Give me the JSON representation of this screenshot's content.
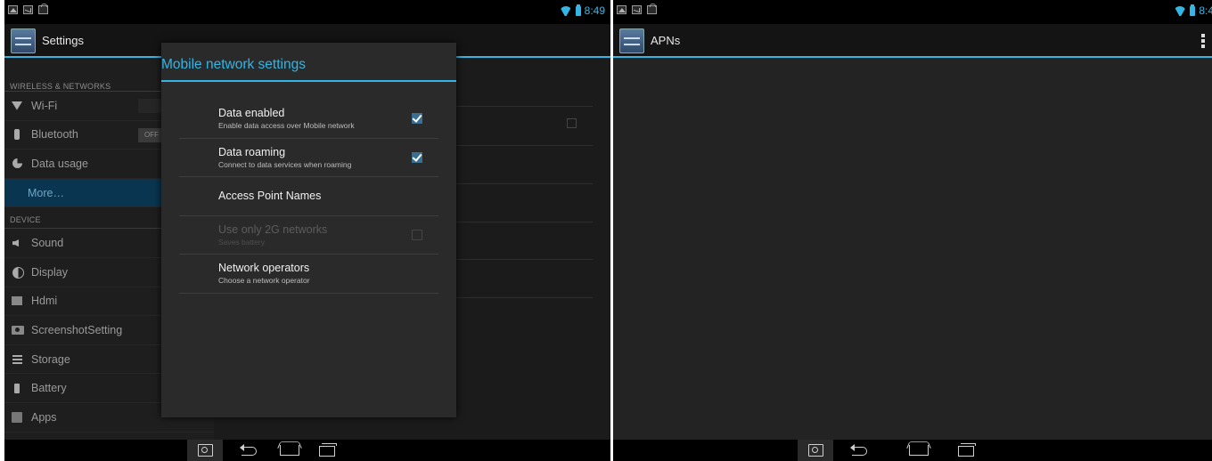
{
  "left_screen": {
    "status_bar": {
      "time": "8:49"
    },
    "action_bar": {
      "title": "Settings"
    },
    "settings_list": {
      "sections": [
        {
          "header": "WIRELESS & NETWORKS"
        },
        {
          "header": "DEVICE"
        }
      ],
      "items": [
        {
          "label": "Wi-Fi",
          "icon": "wifi-icon"
        },
        {
          "label": "Bluetooth",
          "icon": "bluetooth-icon",
          "toggle": "OFF"
        },
        {
          "label": "Data usage",
          "icon": "data-usage-icon"
        },
        {
          "label": "More…",
          "icon": "",
          "selected": true
        },
        {
          "label": "Sound",
          "icon": "sound-icon"
        },
        {
          "label": "Display",
          "icon": "display-icon"
        },
        {
          "label": "Hdmi",
          "icon": "hdmi-icon"
        },
        {
          "label": "ScreenshotSetting",
          "icon": "camera-icon"
        },
        {
          "label": "Storage",
          "icon": "storage-icon"
        },
        {
          "label": "Battery",
          "icon": "battery-icon"
        },
        {
          "label": "Apps",
          "icon": "apps-icon"
        }
      ]
    },
    "dialog": {
      "title": "Mobile network settings",
      "items": [
        {
          "title": "Data enabled",
          "summary": "Enable data access over Mobile network",
          "checked": true
        },
        {
          "title": "Data roaming",
          "summary": "Connect to data services when roaming",
          "checked": true
        },
        {
          "title": "Access Point Names",
          "summary": ""
        },
        {
          "title": "Use only 2G networks",
          "summary": "Saves battery",
          "checked": false,
          "disabled": true
        },
        {
          "title": "Network operators",
          "summary": "Choose a network operator"
        }
      ]
    }
  },
  "right_screen": {
    "status_bar": {
      "time": "8:4"
    },
    "action_bar": {
      "title": "APNs"
    }
  },
  "colors": {
    "accent": "#33b5e5",
    "background": "#1b1b1b",
    "dialog": "#2a2a2a",
    "selected": "#0a3550"
  }
}
